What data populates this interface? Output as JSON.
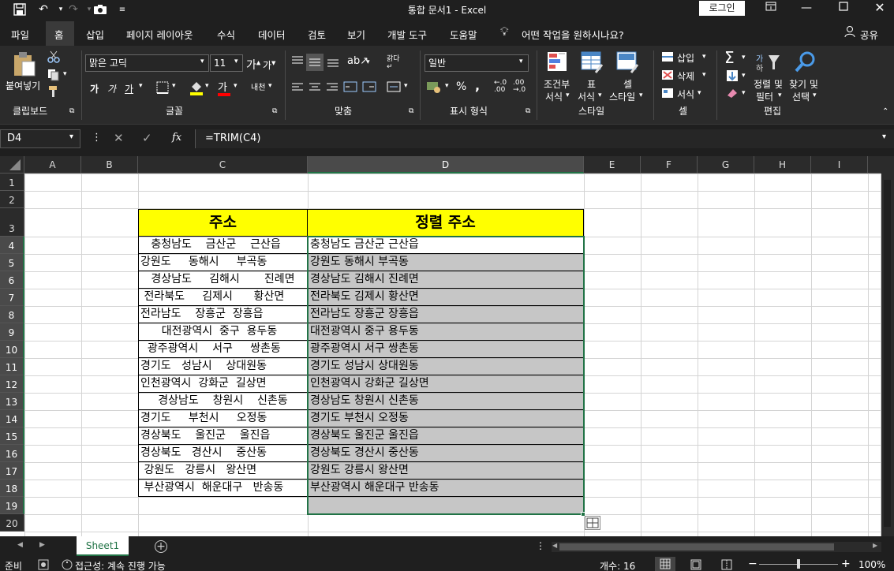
{
  "title_bar": {
    "title": "통합 문서1  -  Excel",
    "login_label": "로그인"
  },
  "menu": {
    "tabs": [
      "파일",
      "홈",
      "삽입",
      "페이지 레이아웃",
      "수식",
      "데이터",
      "검토",
      "보기",
      "개발 도구",
      "도움말"
    ],
    "tell_me": "어떤 작업을 원하시나요?",
    "share": "공유"
  },
  "ribbon": {
    "clipboard": {
      "paste": "붙여넣기",
      "group": "클립보드"
    },
    "font": {
      "name": "맑은 고딕",
      "size": "11",
      "group": "글꼴",
      "bold": "가",
      "italic": "가",
      "underline": "가",
      "phonetic": "내천"
    },
    "alignment": {
      "group": "맞춤"
    },
    "number": {
      "format": "일반",
      "group": "표시 형식",
      "percent": "%",
      "comma": ","
    },
    "styles": {
      "conditional_1": "조건부",
      "conditional_2": "서식",
      "table_1": "표",
      "table_2": "서식",
      "cell_1": "셀",
      "cell_2": "스타일",
      "group": "스타일"
    },
    "cells": {
      "insert": "삽입",
      "delete": "삭제",
      "format": "서식",
      "group": "셀"
    },
    "editing": {
      "sort_1": "정렬 및",
      "sort_2": "필터",
      "find_1": "찾기 및",
      "find_2": "선택",
      "group": "편집"
    }
  },
  "formula_bar": {
    "name_box": "D4",
    "formula": "=TRIM(C4)"
  },
  "columns": [
    "A",
    "B",
    "C",
    "D",
    "E",
    "F",
    "G",
    "H",
    "I"
  ],
  "rows": [
    "1",
    "2",
    "3",
    "4",
    "5",
    "6",
    "7",
    "8",
    "9",
    "10",
    "11",
    "12",
    "13",
    "14",
    "15",
    "16",
    "17",
    "18",
    "19",
    "20"
  ],
  "table": {
    "header_c": "주소",
    "header_d": "정렬 주소",
    "raw_addresses": [
      "   충청남도    금산군    근산읍",
      "강원도     동해시     부곡동",
      "   경상남도     김해시       진례면",
      " 전라북도     김제시      황산면",
      "전라남도    장흥군  장흥읍",
      "      대전광역시  중구  용두동",
      "  광주광역시    서구     쌍촌동",
      "경기도   성남시    상대원동",
      "인천광역시  강화군  길상면",
      "     경상남도    창원시    신촌동",
      "경기도     부천시     오정동",
      "경상북도    울진군    울진읍",
      "경상북도   경산시    중산동",
      " 강원도   강릉시   왕산면",
      " 부산광역시  해운대구   반송동"
    ],
    "trimmed_addresses": [
      "충청남도 금산군 근산읍",
      "강원도 동해시 부곡동",
      "경상남도 김해시 진례면",
      "전라북도 김제시 황산면",
      "전라남도 장흥군 장흥읍",
      "대전광역시 중구 용두동",
      "광주광역시 서구 쌍촌동",
      "경기도 성남시 상대원동",
      "인천광역시 강화군 길상면",
      "경상남도 창원시 신촌동",
      "경기도 부천시 오정동",
      "경상북도 울진군 울진읍",
      "경상북도 경산시 중산동",
      "강원도 강릉시 왕산면",
      "부산광역시 해운대구 반송동"
    ]
  },
  "sheets": {
    "active": "Sheet1"
  },
  "status": {
    "ready": "준비",
    "accessibility": "접근성: 계속 진행 가능",
    "count": "개수: 16",
    "zoom": "100%"
  },
  "colors": {
    "header_fill": "#ffff00",
    "selection_fill": "#c6c6c6",
    "accent": "#217346"
  }
}
